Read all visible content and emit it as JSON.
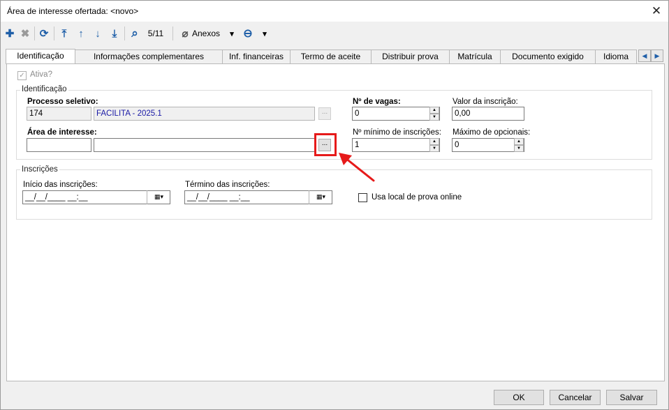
{
  "window": {
    "title": "Área de interesse ofertada: <novo>",
    "close_glyph": "✕"
  },
  "toolbar": {
    "add_glyph": "✚",
    "delete_glyph": "✖",
    "refresh_glyph": "⟳",
    "first_glyph": "⤒",
    "prev_glyph": "↑",
    "next_glyph": "↓",
    "last_glyph": "⤓",
    "search_glyph": "⌕",
    "record_counter": "5/11",
    "attachments_label": "Anexos",
    "attachments_glyph": "⌀",
    "dropdown_glyph": "▾",
    "options_glyph": "⊖"
  },
  "tabs": [
    {
      "label": "Identificação"
    },
    {
      "label": "Informações complementares"
    },
    {
      "label": "Inf. financeiras"
    },
    {
      "label": "Termo de aceite"
    },
    {
      "label": "Distribuir prova"
    },
    {
      "label": "Matrícula"
    },
    {
      "label": "Documento exigido"
    },
    {
      "label": "Idioma"
    }
  ],
  "tabnav": {
    "left_glyph": "◀",
    "right_glyph": "▶"
  },
  "form": {
    "ativa_label": "Ativa?",
    "ativa_check": "✓",
    "identificacao_group": "Identificação",
    "processo_label": "Processo seletivo:",
    "processo_code": "174",
    "processo_name": "FACILITA - 2025.1",
    "browse_glyph": "...",
    "area_label": "Área de interesse:",
    "area_code": "",
    "area_name": "",
    "vagas_label": "Nº de vagas:",
    "vagas_value": "0",
    "valor_label": "Valor da inscrição:",
    "valor_value": "0,00",
    "minimo_label": "Nº mínimo de inscrições:",
    "minimo_value": "1",
    "maximo_label": "Máximo de opcionais:",
    "maximo_value": "0",
    "spin_up": "▲",
    "spin_down": "▼",
    "inscricoes_group": "Inscrições",
    "inicio_label": "Início das inscrições:",
    "inicio_value": "__/__/____ __:__",
    "termino_label": "Término das inscrições:",
    "termino_value": "__/__/____ __:__",
    "calendar_glyph": "▦▾",
    "online_label": "Usa local de prova online"
  },
  "buttons": {
    "ok": "OK",
    "cancel": "Cancelar",
    "save": "Salvar"
  },
  "colors": {
    "accent": "#1f5fa8",
    "highlight": "#e61a1a",
    "link_text": "#1a1aa6"
  }
}
